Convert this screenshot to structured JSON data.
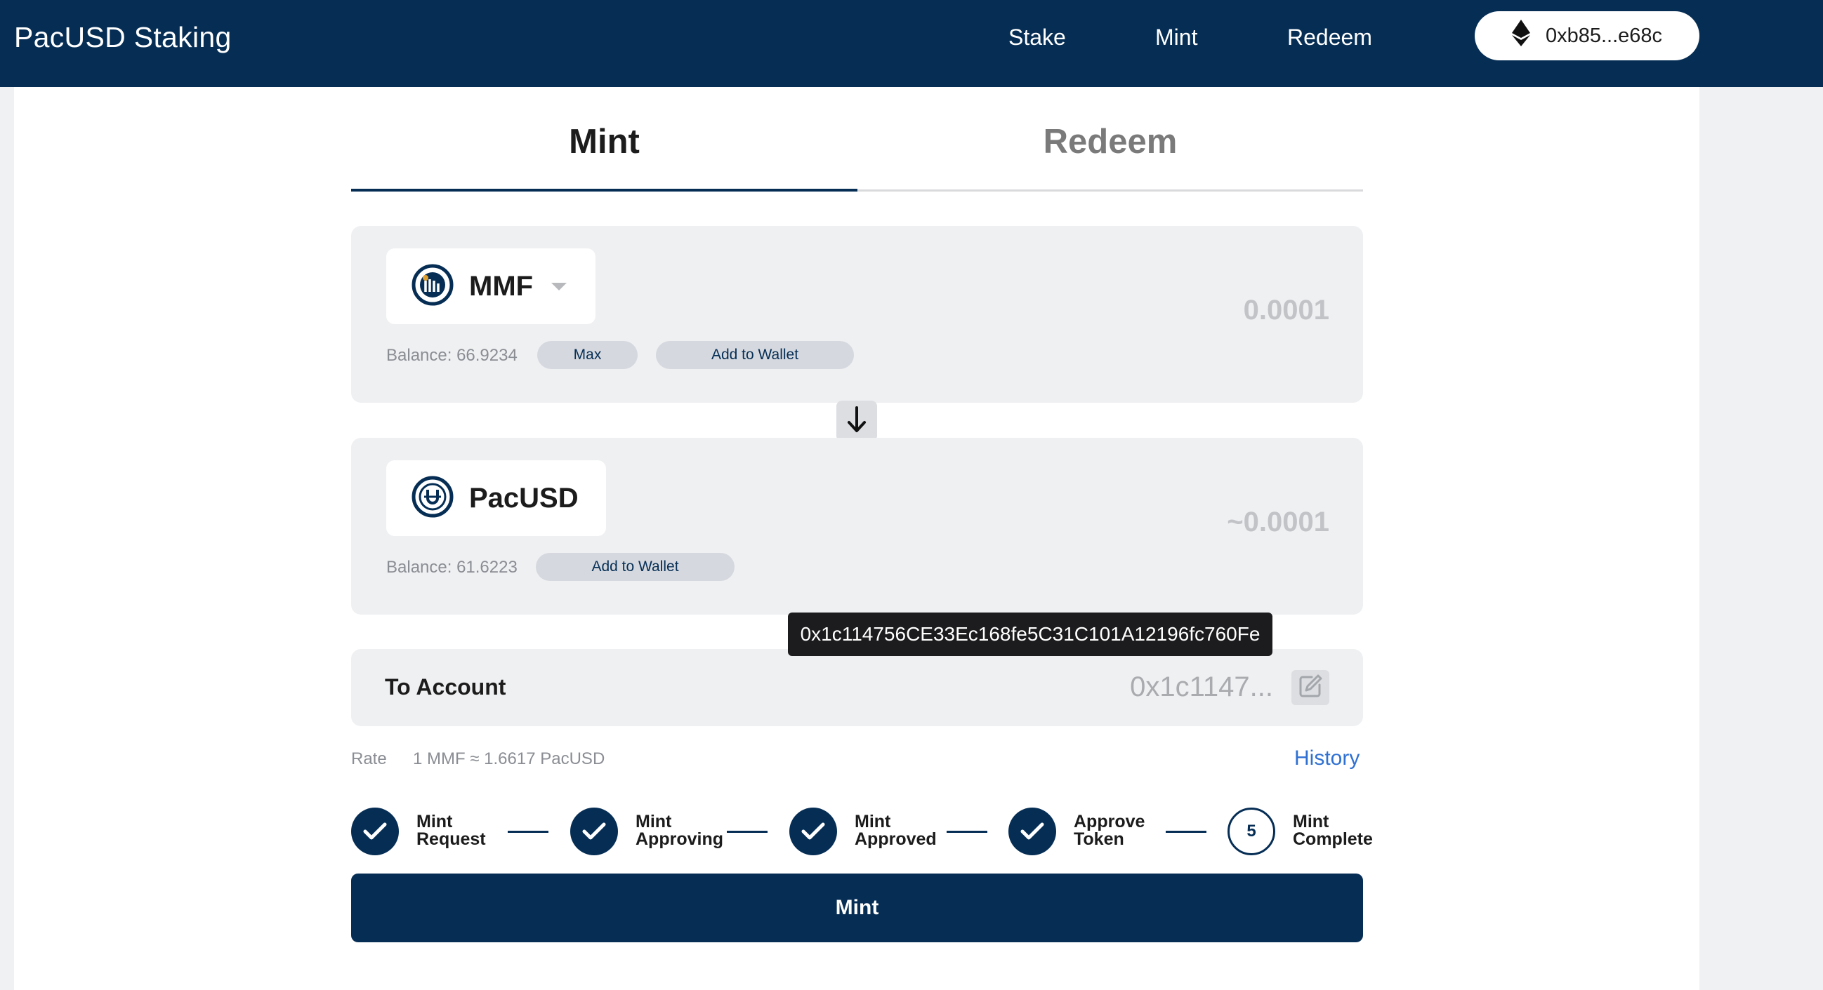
{
  "header": {
    "brand": "PacUSD Staking",
    "nav": [
      "Stake",
      "Mint",
      "Redeem"
    ],
    "wallet_address": "0xb85...e68c"
  },
  "tabs": [
    "Mint",
    "Redeem"
  ],
  "from_card": {
    "token": "MMF",
    "balance": "Balance: 66.9234",
    "max_label": "Max",
    "add_wallet_label": "Add to Wallet",
    "amount": "0.0001"
  },
  "to_card": {
    "token": "PacUSD",
    "balance": "Balance: 61.6223",
    "add_wallet_label": "Add to Wallet",
    "amount": "~0.0001"
  },
  "tooltip": "0x1c114756CE33Ec168fe5C31C101A12196fc760Fe",
  "to_account": {
    "label": "To Account",
    "value": "0x1c1147..."
  },
  "rate": {
    "label": "Rate",
    "value": "1 MMF ≈ 1.6617 PacUSD"
  },
  "history_label": "History",
  "steps": [
    {
      "line1": "Mint",
      "line2": "Request",
      "done": true
    },
    {
      "line1": "Mint",
      "line2": "Approving",
      "done": true
    },
    {
      "line1": "Mint",
      "line2": "Approved",
      "done": true
    },
    {
      "line1": "Approve",
      "line2": "Token",
      "done": true
    },
    {
      "line1": "Mint",
      "line2": "Complete",
      "done": false,
      "number": "5"
    }
  ],
  "mint_button": "Mint",
  "colors": {
    "navy": "#062e55",
    "link": "#2f70d2",
    "card_bg": "#eff0f2"
  }
}
